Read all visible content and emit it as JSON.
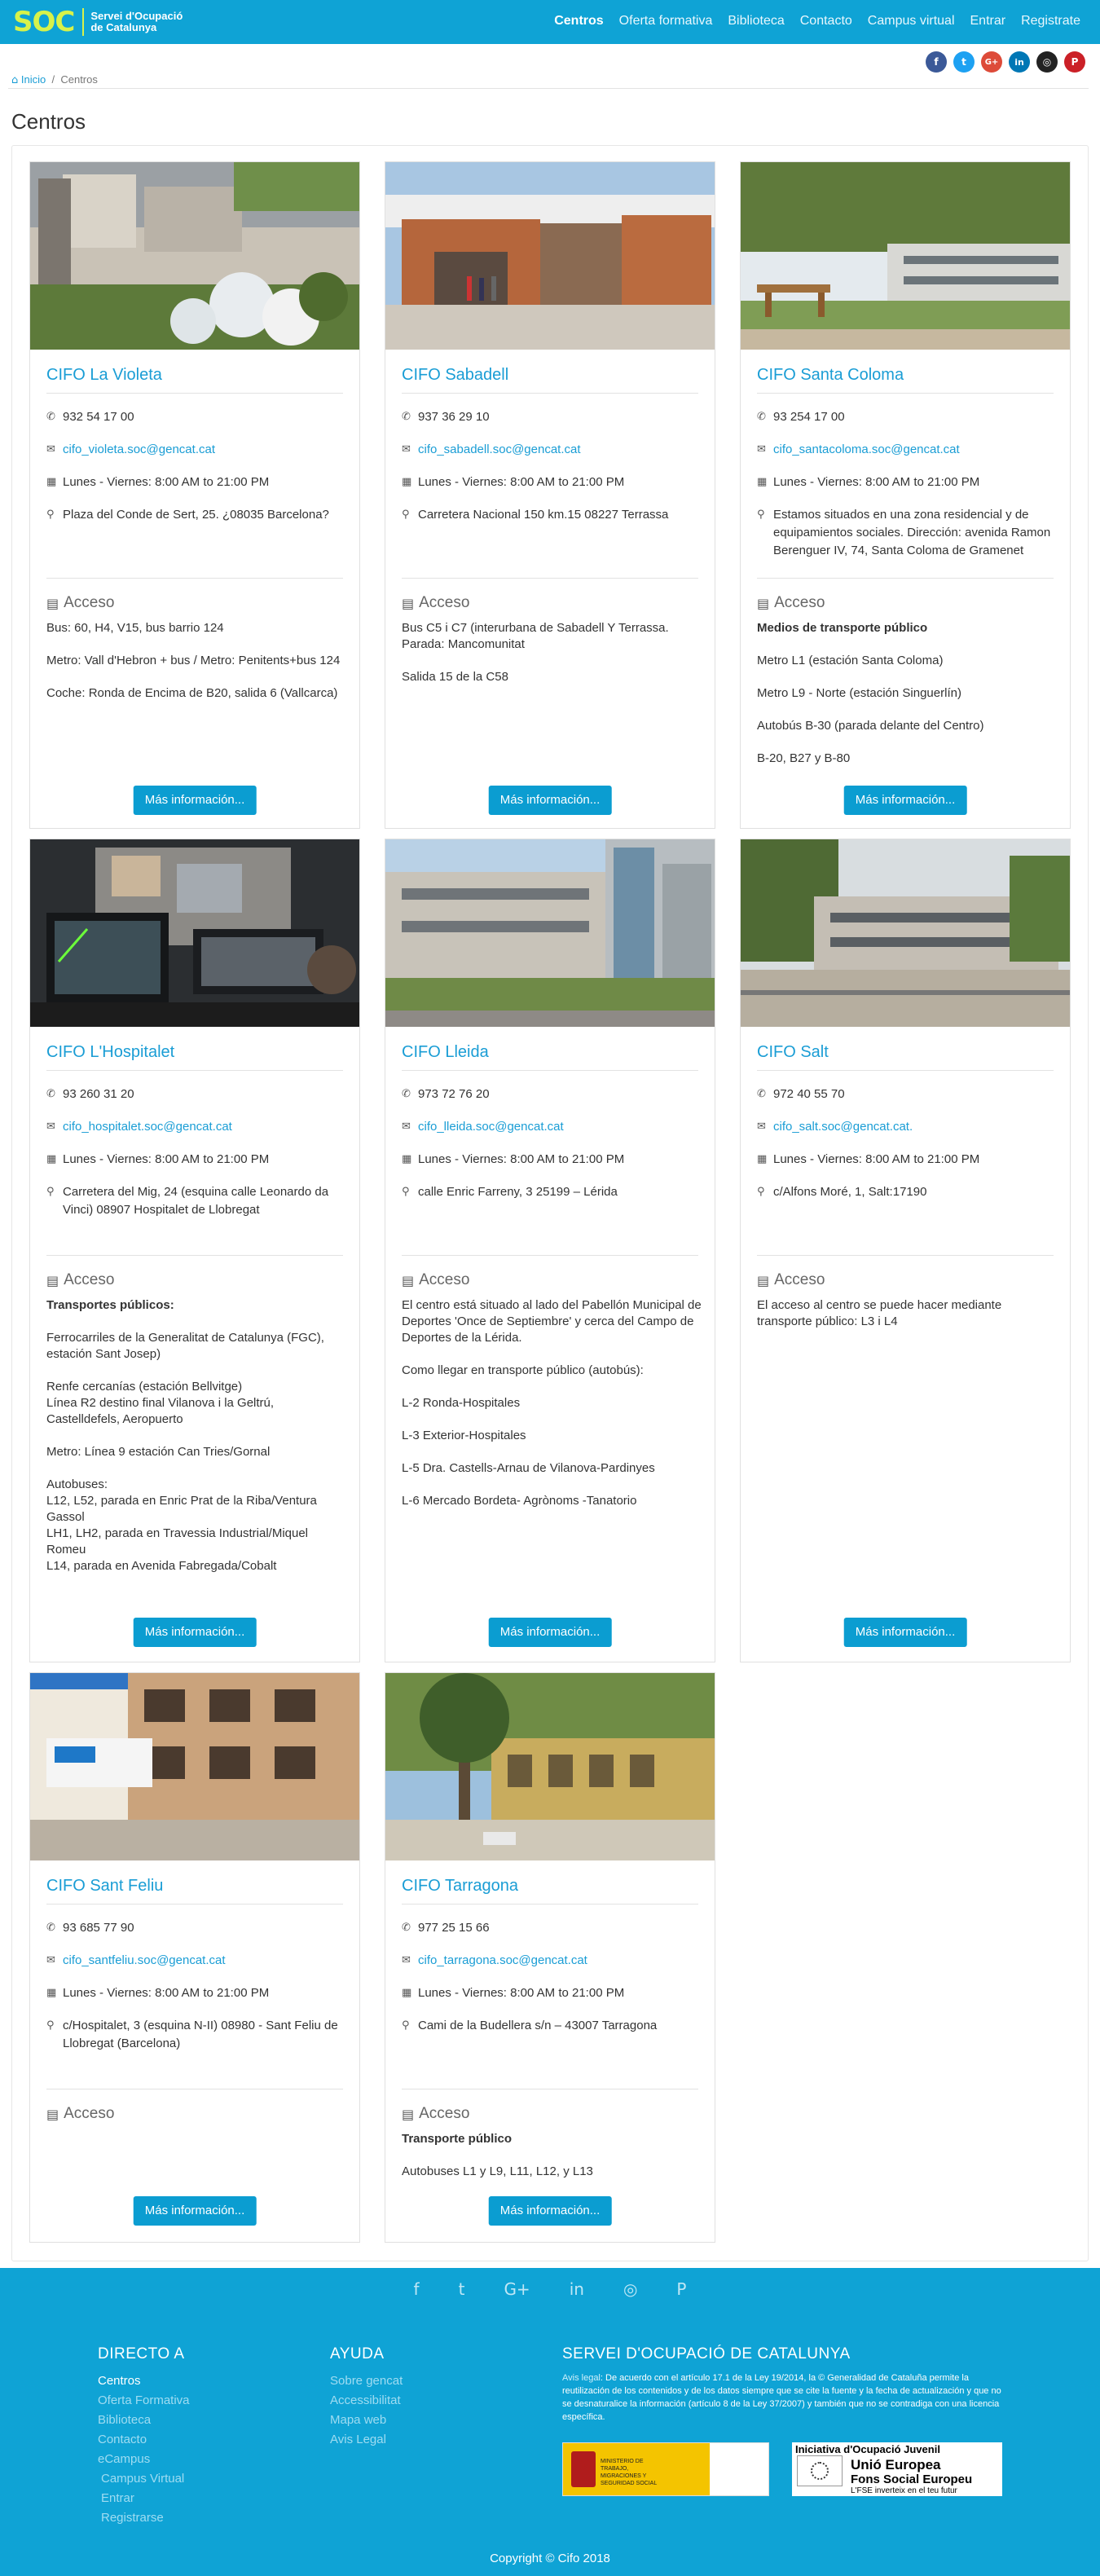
{
  "header": {
    "logo_text": "SOC",
    "logo_sub1": "Servei d'Ocupació",
    "logo_sub2": "de Catalunya",
    "nav": [
      "Centros",
      "Oferta formativa",
      "Biblioteca",
      "Contacto",
      "Campus virtual",
      "Entrar",
      "Registrate"
    ]
  },
  "social": {
    "items": [
      {
        "name": "facebook",
        "glyph": "f",
        "color": "#3b5998"
      },
      {
        "name": "twitter",
        "glyph": "t",
        "color": "#1da1f2"
      },
      {
        "name": "google-plus",
        "glyph": "G+",
        "color": "#dd4b39"
      },
      {
        "name": "linkedin",
        "glyph": "in",
        "color": "#0077b5"
      },
      {
        "name": "instagram",
        "glyph": "◎",
        "color": "#222222"
      },
      {
        "name": "pinterest",
        "glyph": "P",
        "color": "#cb2027"
      }
    ]
  },
  "breadcrumb": {
    "home": "Inicio",
    "sep": "/",
    "current": "Centros"
  },
  "page_title": "Centros",
  "labels": {
    "acceso": "Acceso",
    "more": "Más información..."
  },
  "cards": [
    {
      "title": "CIFO La Violeta",
      "phone": "932 54 17 00",
      "email": "cifo_violeta.soc@gencat.cat",
      "hours": "Lunes - Viernes: 8:00 AM to 21:00 PM",
      "address": "Plaza del Conde de Sert, 25. ¿08035 Barcelona?",
      "access": [
        "Bus: 60, H4, V15, bus barrio 124",
        "Metro: Vall d'Hebron + bus / Metro: Penitents+bus 124",
        "Coche: Ronda de Encima de B20, salida 6 (Vallcarca)"
      ]
    },
    {
      "title": "CIFO Sabadell",
      "phone": "937 36 29 10",
      "email": "cifo_sabadell.soc@gencat.cat",
      "hours": "Lunes - Viernes: 8:00 AM to 21:00 PM",
      "address": "Carretera Nacional 150 km.15 08227 Terrassa",
      "access": [
        "Bus C5 i C7 (interurbana de Sabadell Y Terrassa. Parada: Mancomunitat",
        "Salida 15 de la C58"
      ]
    },
    {
      "title": "CIFO Santa Coloma",
      "phone": "93 254 17 00",
      "email": "cifo_santacoloma.soc@gencat.cat",
      "hours": "Lunes - Viernes: 8:00 AM to 21:00 PM",
      "address": "Estamos situados en una zona residencial y de equipamientos sociales. Dirección: avenida Ramon Berenguer IV, 74, Santa Coloma de Gramenet",
      "access_heading": "Medios de transporte público",
      "access": [
        "Metro L1 (estación Santa Coloma)",
        "Metro L9 - Norte (estación Singuerlín)",
        "Autobús B-30 (parada delante del Centro)",
        "B-20, B27 y B-80"
      ]
    },
    {
      "title": "CIFO L'Hospitalet",
      "phone": "93 260 31 20",
      "email": "cifo_hospitalet.soc@gencat.cat",
      "hours": "Lunes - Viernes: 8:00 AM to 21:00 PM",
      "address": "Carretera del Mig, 24 (esquina calle Leonardo da Vinci) 08907 Hospitalet de Llobregat",
      "access_heading": "Transportes públicos:",
      "access": [
        "Ferrocarriles de la Generalitat de Catalunya (FGC), estación Sant Josep)",
        "Renfe cercanías (estación Bellvitge)\nLínea R2 destino final Vilanova i la Geltrú, Castelldefels, Aeropuerto",
        "Metro: Línea 9 estación Can Tries/Gornal",
        "Autobuses:\nL12, L52, parada en Enric Prat de la Riba/Ventura Gassol\nLH1, LH2, parada en Travessia Industrial/Miquel Romeu\nL14, parada en Avenida Fabregada/Cobalt"
      ]
    },
    {
      "title": "CIFO Lleida",
      "phone": "973 72 76 20",
      "email": "cifo_lleida.soc@gencat.cat",
      "hours": "Lunes - Viernes: 8:00 AM to 21:00 PM",
      "address": "calle Enric Farreny, 3 25199 – Lérida",
      "access": [
        "El centro está situado al lado del Pabellón Municipal de Deportes 'Once de Septiembre' y cerca del Campo de Deportes de la Lérida.",
        "Como llegar en transporte público (autobús):",
        "L-2 Ronda-Hospitales",
        "L-3 Exterior-Hospitales",
        "L-5 Dra. Castells-Arnau de Vilanova-Pardinyes",
        "L-6 Mercado Bordeta- Agrònoms -Tanatorio"
      ]
    },
    {
      "title": "CIFO Salt",
      "phone": "972 40 55 70",
      "email": "cifo_salt.soc@gencat.cat.",
      "hours": "Lunes - Viernes: 8:00 AM to 21:00 PM",
      "address": "c/Alfons Moré, 1, Salt:17190",
      "access": [
        "El acceso al centro se puede hacer mediante transporte público: L3 i L4"
      ]
    },
    {
      "title": "CIFO Sant Feliu",
      "phone": "93 685 77 90",
      "email": "cifo_santfeliu.soc@gencat.cat",
      "hours": "Lunes - Viernes: 8:00 AM to 21:00 PM",
      "address": "c/Hospitalet, 3 (esquina N-II) 08980 - Sant Feliu de Llobregat (Barcelona)",
      "access": []
    },
    {
      "title": "CIFO Tarragona",
      "phone": "977 25 15 66",
      "email": "cifo_tarragona.soc@gencat.cat",
      "hours": "Lunes - Viernes: 8:00 AM to 21:00 PM",
      "address": "Cami de la Budellera s/n – 43007 Tarragona",
      "access_heading": "Transporte público",
      "access": [
        "Autobuses L1 y L9, L11, L12, y L13"
      ]
    }
  ],
  "footer": {
    "col1": {
      "title": "DIRECTO A",
      "items": [
        "Centros",
        "Oferta Formativa",
        "Biblioteca",
        "Contacto",
        "eCampus",
        "Campus Virtual",
        "Entrar",
        "Registrarse"
      ]
    },
    "col2": {
      "title": "AYUDA",
      "items": [
        "Sobre gencat",
        "Accessibilitat",
        "Mapa web",
        "Avis Legal"
      ]
    },
    "col3": {
      "title": "SERVEI D'OCUPACIÓ DE CATALUNYA",
      "legal_label": "Avis legal",
      "legal_text": ": De acuerdo con el artículo 17.1 de la Ley 19/2014, la © Generalidad de Cataluña permite la reutilización de los contenidos y de los datos siempre que se cite la fuente y la fecha de actualización y que no se desnaturalice la información (artículo 8 de la Ley 37/2007) y también que no se contradiga con una licencia específica.",
      "ministry_text": "MINISTERIO DE TRABAJO, MIGRACIONES Y SEGURIDAD SOCIAL",
      "eu_line1": "Iniciativa d'Ocupació Juvenil",
      "eu_line2": "Unió Europea",
      "eu_line3": "Fons Social Europeu",
      "eu_line4": "L'FSE inverteix en el teu futur"
    },
    "copyright": "Copyright © Cifo 2018"
  },
  "colors": {
    "brand": "#0fa3d5",
    "link": "#1a9dd5",
    "button": "#0b9dd1",
    "logo": "#d7f24a"
  }
}
